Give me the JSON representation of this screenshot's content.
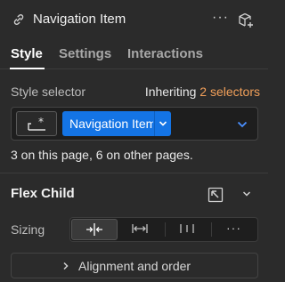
{
  "header": {
    "title": "Navigation Item",
    "more_label": "···",
    "link_icon": "link-icon",
    "cube_icon": "add-component-icon"
  },
  "tabs": [
    {
      "label": "Style",
      "active": true
    },
    {
      "label": "Settings",
      "active": false
    },
    {
      "label": "Interactions",
      "active": false
    }
  ],
  "style_selector": {
    "label": "Style selector",
    "inheriting_prefix": "Inheriting",
    "inheriting_count": "2 selectors",
    "chip_label": "Navigation Item",
    "page_count_text": "3 on this page, 6 on other pages."
  },
  "flex_child": {
    "title": "Flex Child",
    "sizing_label": "Sizing",
    "sizing_options": [
      "shrink",
      "grow",
      "none",
      "more"
    ],
    "sizing_selected": "shrink",
    "more_label": "···",
    "alignment_label": "Alignment and order"
  },
  "colors": {
    "background": "#2b2b2b",
    "accent_blue": "#1474e5",
    "orange": "#f2a05a",
    "caret_blue": "#4a90ff"
  }
}
